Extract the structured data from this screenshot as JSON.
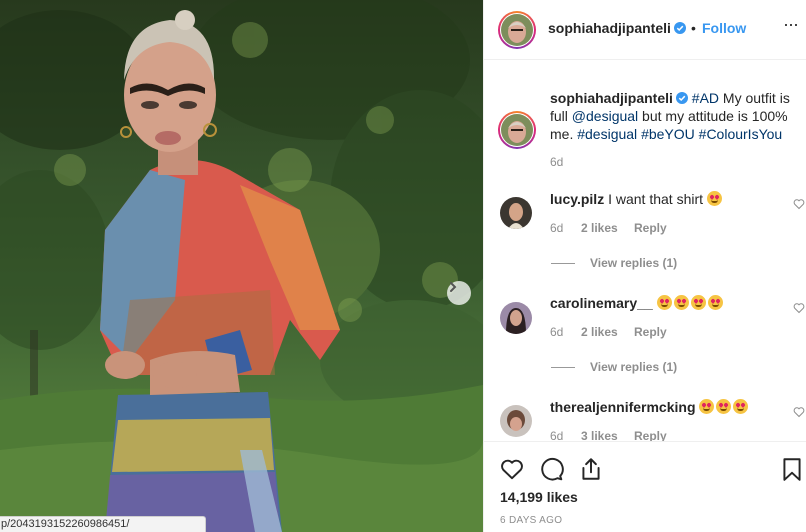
{
  "colors": {
    "accent": "#3897f0",
    "hashtag": "#003569",
    "muted": "#8e8e8e",
    "text": "#262626"
  },
  "status_bar": {
    "url": "p/2043193152260986451/"
  },
  "header": {
    "username": "sophiahadjipanteli",
    "separator": "•",
    "follow_label": "Follow",
    "more_label": "···"
  },
  "caption": {
    "username": "sophiahadjipanteli",
    "parts": [
      "#AD",
      " My outfit is full ",
      "@desigual",
      " but my attitude is 100% me. ",
      "#desigual",
      " ",
      "#beYOU",
      " ",
      "#ColourIsYou"
    ],
    "age": "6d"
  },
  "comments": [
    {
      "username": "lucy.pilz",
      "text": "I want that shirt",
      "emoji_count": 1,
      "age": "6d",
      "likes": "2 likes",
      "reply": "Reply",
      "view_replies": "View replies (1)"
    },
    {
      "username": "carolinemary__",
      "text": "",
      "emoji_count": 4,
      "age": "6d",
      "likes": "2 likes",
      "reply": "Reply",
      "view_replies": "View replies (1)"
    },
    {
      "username": "therealjennifermcking",
      "text": "",
      "emoji_count": 3,
      "age": "6d",
      "likes": "3 likes",
      "reply": "Reply"
    }
  ],
  "actions": {
    "icons": [
      "heart-icon",
      "comment-icon",
      "share-icon",
      "bookmark-icon"
    ]
  },
  "likes_count": "14,199 likes",
  "posted_time": "6 DAYS AGO"
}
